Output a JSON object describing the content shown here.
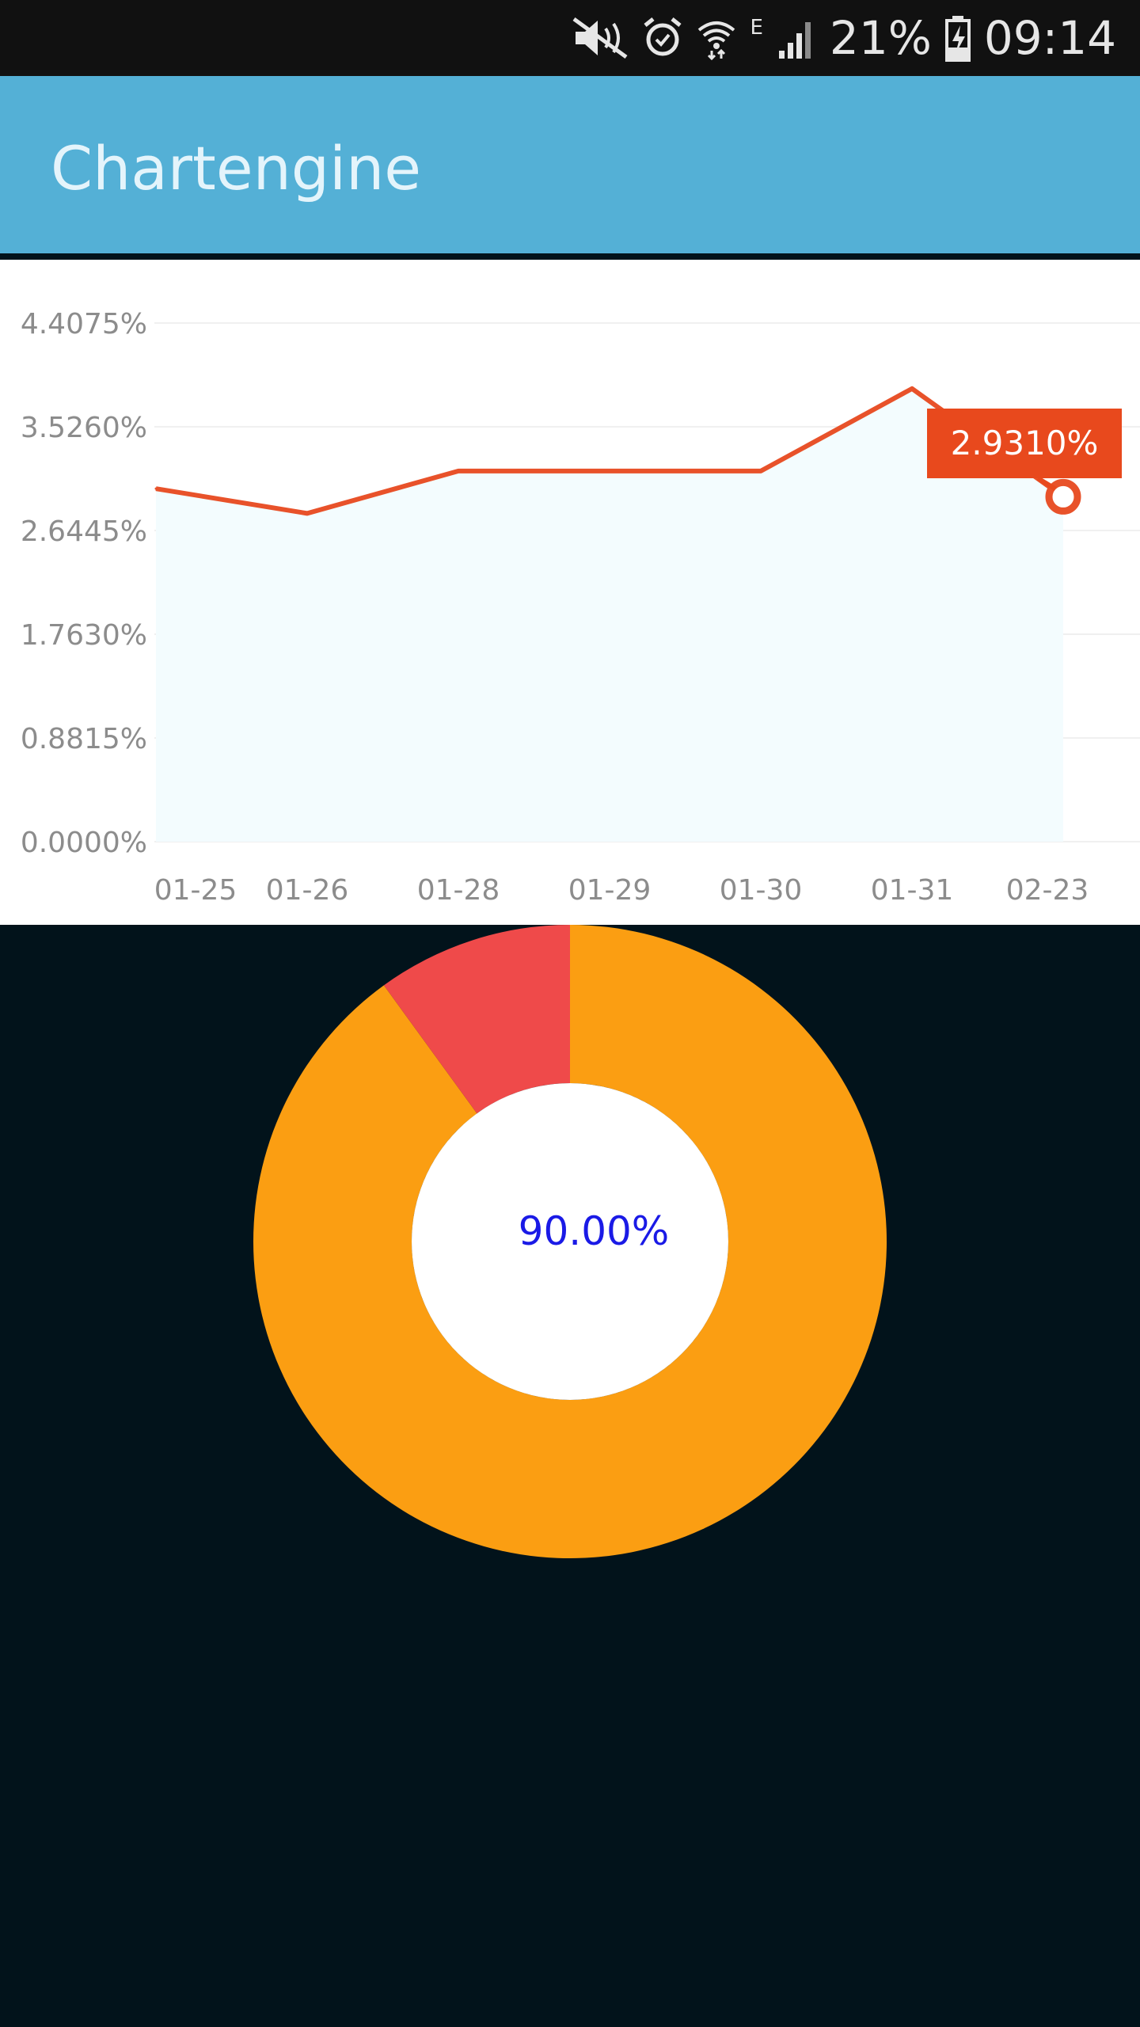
{
  "status_bar": {
    "battery": "21%",
    "time": "09:14",
    "network_type": "E",
    "icons": [
      "mute-icon",
      "alarm-icon",
      "wifi-icon",
      "signal-icon",
      "battery-charging-icon"
    ]
  },
  "app_bar": {
    "title": "Chartengine"
  },
  "colors": {
    "app_bar": "#54b0d6",
    "line": "#e8522a",
    "area_fill": "#f3fcfe",
    "tooltip": "#e8491d",
    "donut_major": "#fb9e12",
    "donut_minor": "#ef4a4a",
    "center_text": "#1a1ae6",
    "background": "#02131b"
  },
  "chart_data": [
    {
      "type": "area",
      "categories": [
        "01-25",
        "01-26",
        "01-28",
        "01-29",
        "01-30",
        "01-31",
        "02-23"
      ],
      "values": [
        3.0,
        2.79,
        3.15,
        3.15,
        3.15,
        3.85,
        2.931
      ],
      "y_ticks": [
        "4.4075%",
        "3.5260%",
        "2.6445%",
        "1.7630%",
        "0.8815%",
        "0.0000%"
      ],
      "ylim": [
        0,
        4.4075
      ],
      "grid": true,
      "tooltip": {
        "category": "02-23",
        "label": "2.9310%"
      }
    },
    {
      "type": "pie",
      "donut": true,
      "slices": [
        {
          "value": 90
        },
        {
          "value": 10
        }
      ],
      "center_label": "90.00%"
    }
  ]
}
